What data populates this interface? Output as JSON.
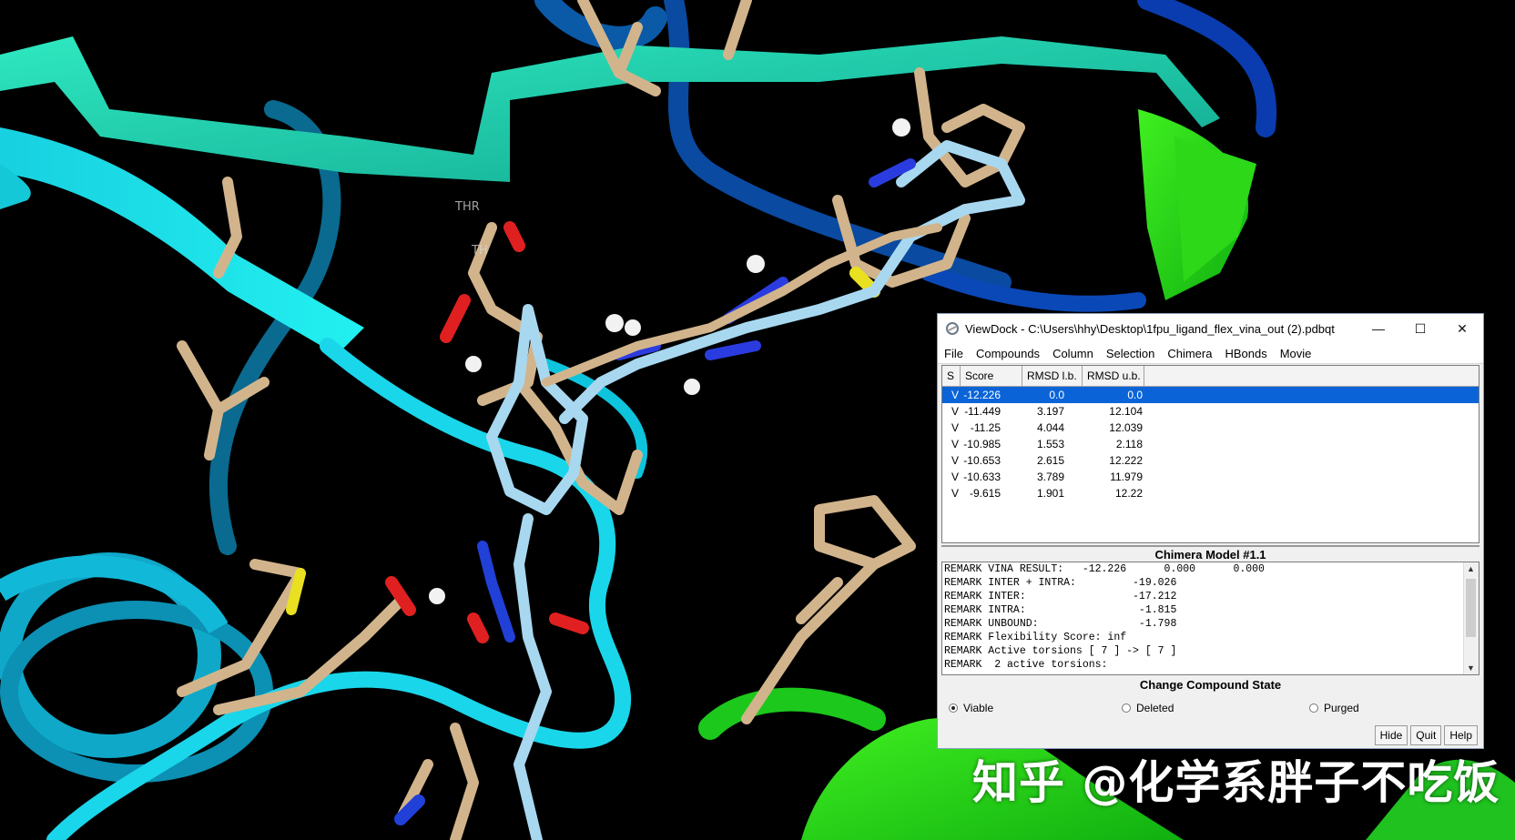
{
  "scene": {
    "residue_labels": [
      "THR",
      "TH"
    ]
  },
  "watermark": "知乎 @化学系胖子不吃饭",
  "window": {
    "title": "ViewDock - C:\\Users\\hhy\\Desktop\\1fpu_ligand_flex_vina_out (2).pdbqt",
    "controls": {
      "minimize": "—",
      "maximize": "☐",
      "close": "✕"
    },
    "menu": [
      "File",
      "Compounds",
      "Column",
      "Selection",
      "Chimera",
      "HBonds",
      "Movie"
    ],
    "table": {
      "headers": [
        "S",
        "Score",
        "RMSD l.b.",
        "RMSD u.b."
      ],
      "rows": [
        {
          "s": "V",
          "score": "-12.226",
          "lb": "0.0",
          "ub": "0.0",
          "selected": true
        },
        {
          "s": "V",
          "score": "-11.449",
          "lb": "3.197",
          "ub": "12.104"
        },
        {
          "s": "V",
          "score": "-11.25",
          "lb": "4.044",
          "ub": "12.039"
        },
        {
          "s": "V",
          "score": "-10.985",
          "lb": "1.553",
          "ub": "2.118"
        },
        {
          "s": "V",
          "score": "-10.653",
          "lb": "2.615",
          "ub": "12.222"
        },
        {
          "s": "V",
          "score": "-10.633",
          "lb": "3.789",
          "ub": "11.979"
        },
        {
          "s": "V",
          "score": "-9.615",
          "lb": "1.901",
          "ub": "12.22"
        }
      ]
    },
    "model_title": "Chimera Model #1.1",
    "remarks": [
      "REMARK VINA RESULT:   -12.226      0.000      0.000",
      "REMARK INTER + INTRA:         -19.026",
      "REMARK INTER:                 -17.212",
      "REMARK INTRA:                  -1.815",
      "REMARK UNBOUND:                -1.798",
      "REMARK Flexibility Score: inf",
      "REMARK Active torsions [ 7 ] -> [ 7 ]",
      "REMARK  2 active torsions:"
    ],
    "state_title": "Change Compound State",
    "states": [
      {
        "label": "Viable",
        "checked": true
      },
      {
        "label": "Deleted",
        "checked": false
      },
      {
        "label": "Purged",
        "checked": false
      }
    ],
    "buttons": [
      "Hide",
      "Quit",
      "Help"
    ]
  }
}
